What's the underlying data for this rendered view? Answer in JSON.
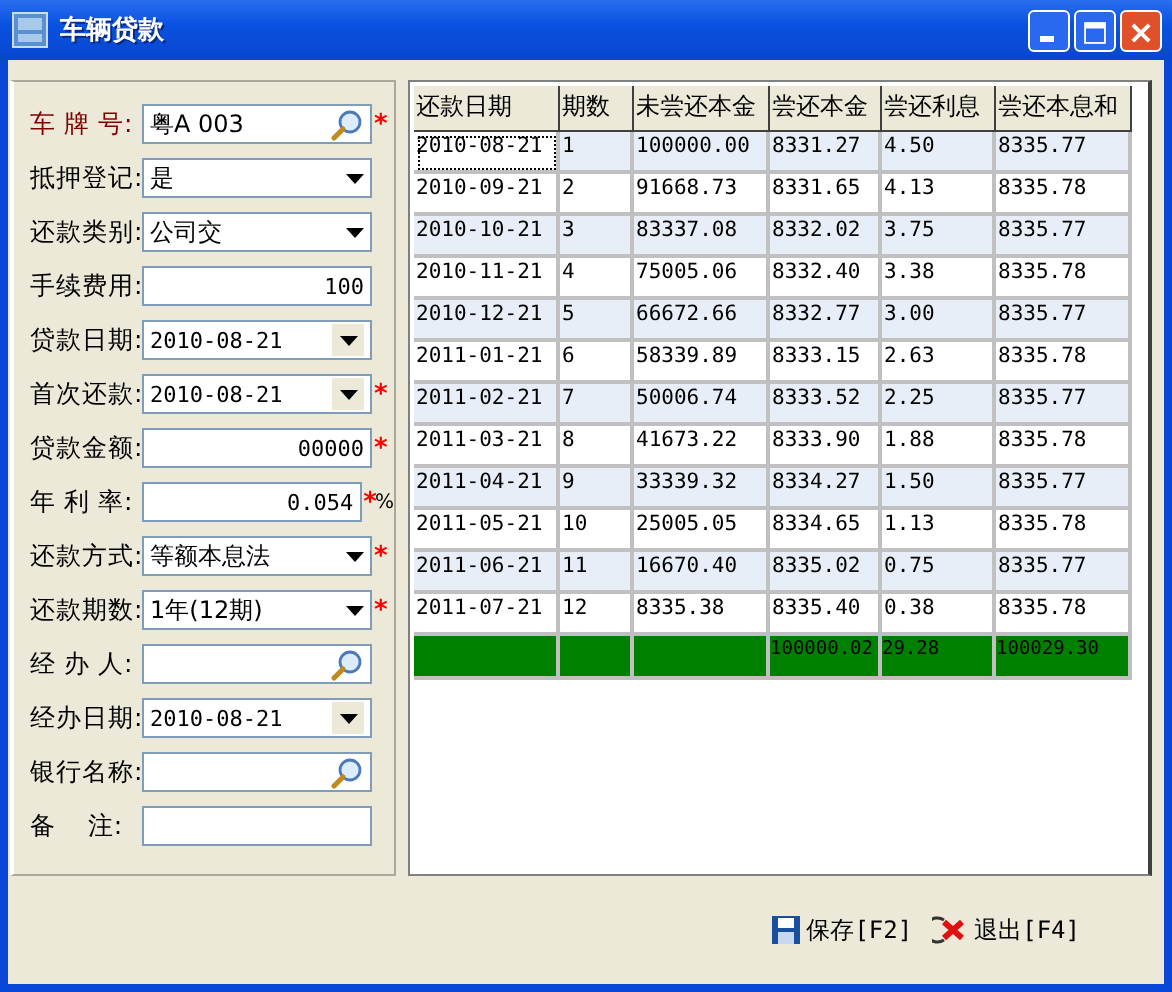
{
  "window": {
    "title": "车辆贷款"
  },
  "form": {
    "fields": [
      {
        "label": "车 牌 号:",
        "value": "粤A 003",
        "kind": "search",
        "required_mark": "*",
        "highlight": true
      },
      {
        "label": "抵押登记:",
        "value": "是",
        "kind": "select",
        "highlight": false
      },
      {
        "label": "还款类别:",
        "value": "公司交",
        "kind": "select",
        "highlight": false
      },
      {
        "label": "手续费用:",
        "value": "100",
        "kind": "number",
        "highlight": false
      },
      {
        "label": "贷款日期:",
        "value": "2010-08-21",
        "kind": "date",
        "highlight": false
      },
      {
        "label": "首次还款:",
        "value": "2010-08-21",
        "kind": "date",
        "required_mark": "*",
        "highlight": false
      },
      {
        "label": "贷款金额:",
        "value": "00000",
        "kind": "number",
        "required_mark": "*",
        "highlight": false
      },
      {
        "label": "年 利 率:",
        "value": "0.054",
        "kind": "number",
        "required_mark": "*",
        "highlight": false,
        "suffix": "%"
      },
      {
        "label": "还款方式:",
        "value": "等额本息法",
        "kind": "select",
        "required_mark": "*",
        "highlight": false
      },
      {
        "label": "还款期数:",
        "value": "1年(12期)",
        "kind": "select",
        "required_mark": "*",
        "highlight": false
      },
      {
        "label": "经 办 人:",
        "kind": "search",
        "highlight": false
      },
      {
        "label": "经办日期:",
        "value": "2010-08-21",
        "kind": "date",
        "highlight": false
      },
      {
        "label": "银行名称:",
        "kind": "search",
        "highlight": false
      },
      {
        "label": "备    注:",
        "kind": "text",
        "highlight": false
      }
    ]
  },
  "table": {
    "columns": [
      "还款日期",
      "期数",
      "未尝还本金",
      "尝还本金",
      "尝还利息",
      "尝还本息和"
    ],
    "rows": [
      {
        "cells": [
          "2010-08-21",
          "1",
          "100000.00",
          "8331.27",
          "4.50",
          "8335.77"
        ],
        "selected": true
      },
      {
        "cells": [
          "2010-09-21",
          "2",
          "91668.73",
          "8331.65",
          "4.13",
          "8335.78"
        ],
        "selected": false
      },
      {
        "cells": [
          "2010-10-21",
          "3",
          "83337.08",
          "8332.02",
          "3.75",
          "8335.77"
        ],
        "selected": false
      },
      {
        "cells": [
          "2010-11-21",
          "4",
          "75005.06",
          "8332.40",
          "3.38",
          "8335.78"
        ],
        "selected": false
      },
      {
        "cells": [
          "2010-12-21",
          "5",
          "66672.66",
          "8332.77",
          "3.00",
          "8335.77"
        ],
        "selected": false
      },
      {
        "cells": [
          "2011-01-21",
          "6",
          "58339.89",
          "8333.15",
          "2.63",
          "8335.78"
        ],
        "selected": false
      },
      {
        "cells": [
          "2011-02-21",
          "7",
          "50006.74",
          "8333.52",
          "2.25",
          "8335.77"
        ],
        "selected": false
      },
      {
        "cells": [
          "2011-03-21",
          "8",
          "41673.22",
          "8333.90",
          "1.88",
          "8335.78"
        ],
        "selected": false
      },
      {
        "cells": [
          "2011-04-21",
          "9",
          "33339.32",
          "8334.27",
          "1.50",
          "8335.77"
        ],
        "selected": false
      },
      {
        "cells": [
          "2011-05-21",
          "10",
          "25005.05",
          "8334.65",
          "1.13",
          "8335.78"
        ],
        "selected": false
      },
      {
        "cells": [
          "2011-06-21",
          "11",
          "16670.40",
          "8335.02",
          "0.75",
          "8335.77"
        ],
        "selected": false
      },
      {
        "cells": [
          "2011-07-21",
          "12",
          "8335.38",
          "8335.40",
          "0.38",
          "8335.78"
        ],
        "selected": false
      }
    ],
    "total": {
      "principal": "100000.02",
      "interest": "29.28",
      "principal_and_interest": "100029.30"
    }
  },
  "buttons": [
    {
      "label": "保存[F2]",
      "kind": "save"
    },
    {
      "label": "退出[F4]",
      "kind": "exit"
    }
  ]
}
